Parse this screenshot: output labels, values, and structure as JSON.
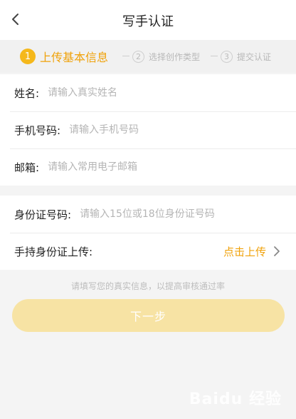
{
  "header": {
    "title": "写手认证"
  },
  "steps": [
    {
      "num": "1",
      "label": "上传基本信息",
      "active": true
    },
    {
      "num": "2",
      "label": "选择创作类型",
      "active": false
    },
    {
      "num": "3",
      "label": "提交认证",
      "active": false
    }
  ],
  "form": {
    "name_label": "姓名:",
    "name_placeholder": "请输入真实姓名",
    "phone_label": "手机号码:",
    "phone_placeholder": "请输入手机号码",
    "email_label": "邮箱:",
    "email_placeholder": "请输入常用电子邮箱",
    "idcard_label": "身份证号码:",
    "idcard_placeholder": "请输入15位或18位身份证号码",
    "upload_label": "手持身份证上传:",
    "upload_action": "点击上传"
  },
  "hint": "请填写您的真实信息，以提高审核通过率",
  "next_button": "下一步",
  "watermark": "Baidu 经验",
  "colors": {
    "accent": "#f0a20b",
    "step_active": "#f5b81b",
    "button_bg": "#f7e3a4"
  }
}
